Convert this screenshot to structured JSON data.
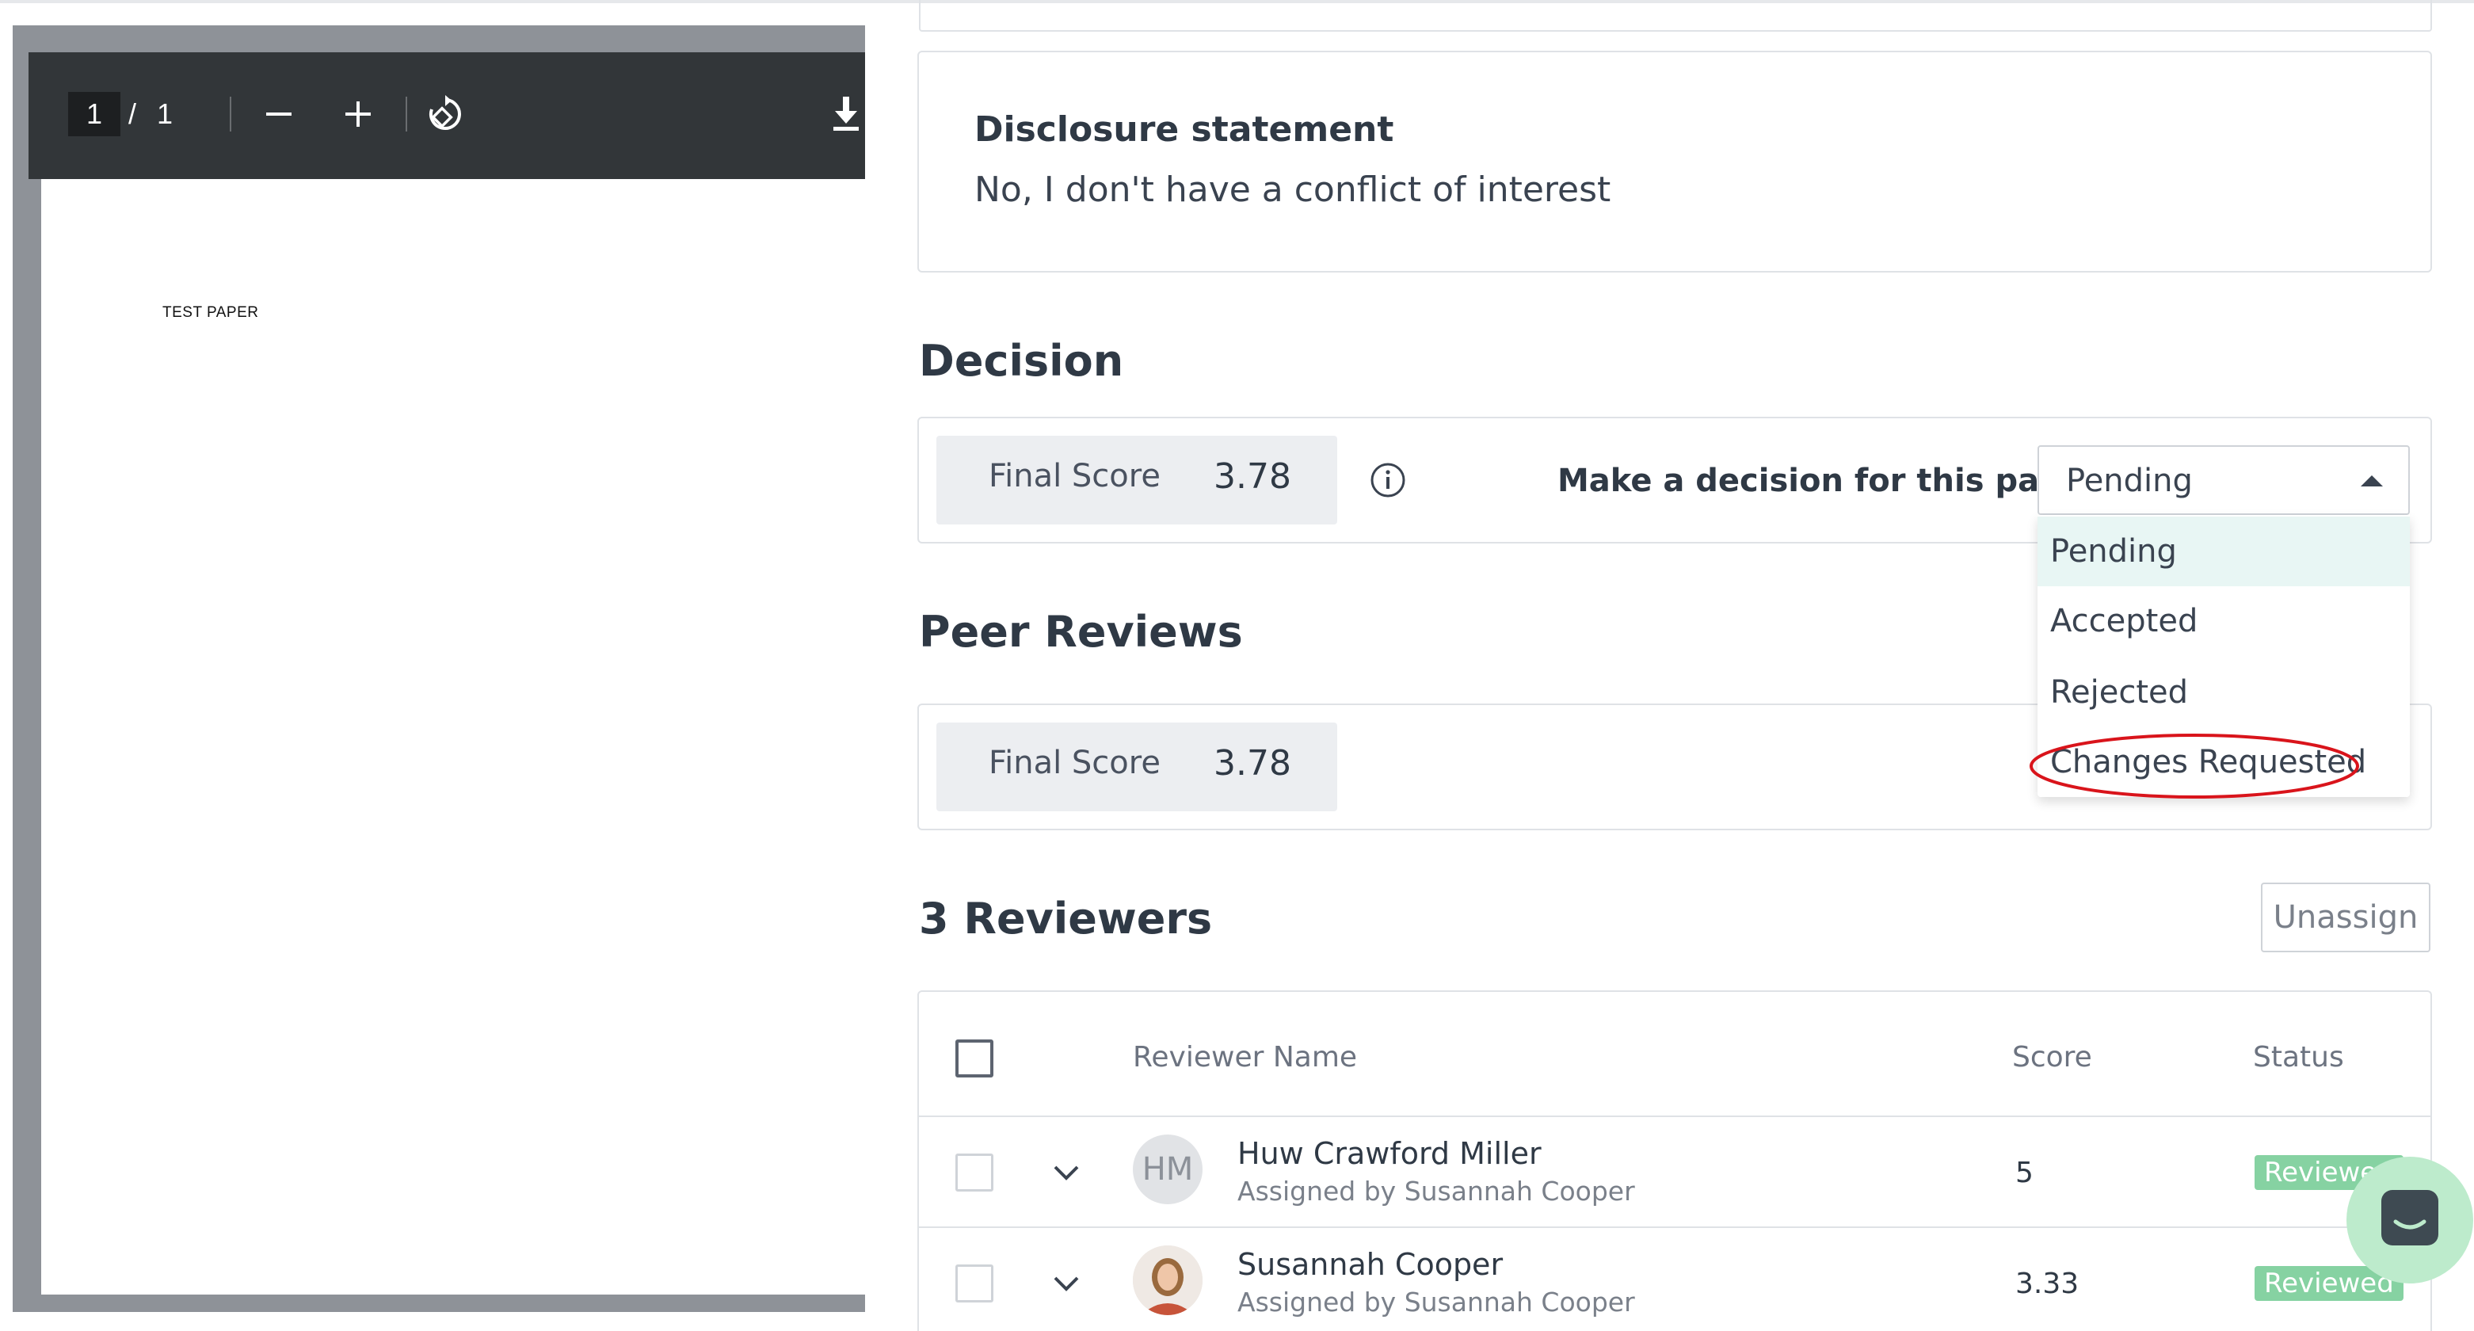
{
  "pdf_viewer": {
    "current_page": "1",
    "separator": "/",
    "total_pages": "1",
    "page_text": "TEST PAPER",
    "icons": [
      "zoom-out-icon",
      "zoom-in-icon",
      "rotate-icon",
      "download-icon"
    ]
  },
  "disclosure": {
    "title": "Disclosure statement",
    "body": "No, I don't have a conflict of interest"
  },
  "decision": {
    "section_title": "Decision",
    "final_score_label": "Final Score",
    "final_score_value": "3.78",
    "prompt": "Make a decision for this paper",
    "selected": "Pending",
    "options": [
      "Pending",
      "Accepted",
      "Rejected",
      "Changes Requested"
    ]
  },
  "peer_reviews": {
    "section_title": "Peer Reviews",
    "final_score_label": "Final Score",
    "final_score_value": "3.78"
  },
  "reviewers": {
    "section_title": "3 Reviewers",
    "unassign_label": "Unassign",
    "columns": {
      "name": "Reviewer Name",
      "score": "Score",
      "status": "Status"
    },
    "rows": [
      {
        "initials": "HM",
        "name": "Huw Crawford Miller",
        "assigned_by": "Assigned by Susannah Cooper",
        "score": "5",
        "status": "Reviewed"
      },
      {
        "initials": "",
        "name": "Susannah Cooper",
        "assigned_by": "Assigned by Susannah Cooper",
        "score": "3.33",
        "status": "Reviewed"
      }
    ]
  },
  "colors": {
    "accent_highlight": "#e8f6f4",
    "status_badge": "#86d2a2",
    "annotation": "#d9141b",
    "chat_bubble": "#bdebcc"
  }
}
